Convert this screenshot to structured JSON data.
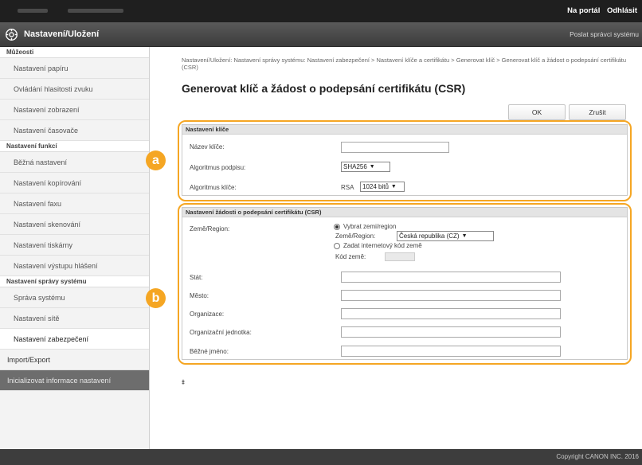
{
  "topbar": {
    "portal_link": "Na portál",
    "logout_link": "Odhlásit"
  },
  "titlebar": {
    "title": "Nastavení/Uložení",
    "mail_link": "Poslat správci systému"
  },
  "sidebar": {
    "cat_preferences": "Můžeosti",
    "items_a": [
      "Nastavení papíru",
      "Ovládání hlasitosti zvuku",
      "Nastavení zobrazení",
      "Nastavení časovače"
    ],
    "cat_functions": "Nastavení funkcí",
    "items_b": [
      "Běžná nastavení",
      "Nastavení kopírování",
      "Nastavení faxu",
      "Nastavení skenování",
      "Nastavení tiskárny",
      "Nastavení výstupu hlášení"
    ],
    "cat_system": "Nastavení správy systému",
    "items_c": [
      "Správa systému",
      "Nastavení sítě",
      "Nastavení zabezpečení"
    ],
    "import_export": "Import/Export",
    "init_info": "Inicializovat informace nastavení"
  },
  "main": {
    "breadcrumb": "Nastavení/Uložení: Nastavení správy systému: Nastavení zabezpečení > Nastavení klíče a certifikátu > Generovat klíč > Generovat klíč a žádost o podepsání certifikátu (CSR)",
    "page_title": "Generovat klíč a žádost o podepsání certifikátu (CSR)",
    "ok_button": "OK",
    "cancel_button": "Zrušit",
    "key_section": {
      "header": "Nastavení klíče",
      "key_name_label": "Název klíče:",
      "key_name_value": "",
      "sig_algo_label": "Algoritmus podpisu:",
      "sig_algo_value": "SHA256",
      "key_algo_label": "Algoritmus klíče:",
      "key_algo_type": "RSA",
      "key_algo_value": "1024 bitů"
    },
    "csr_section": {
      "header": "Nastavení žádosti o podepsání certifikátu (CSR)",
      "country_label": "Země/Region:",
      "radio_select": "Vybrat zemi/region",
      "country_sub_label": "Země/Region:",
      "country_value": "Česká republika (CZ)",
      "radio_internet": "Zadat internetový kód země",
      "country_code_label": "Kód země:",
      "state_label": "Stát:",
      "city_label": "Město:",
      "org_label": "Organizace:",
      "unit_label": "Organizační jednotka:",
      "common_name_label": "Běžné jméno:"
    },
    "to_top": "⯒"
  },
  "annotations": {
    "badge_a": "a",
    "badge_b": "b"
  },
  "footer": {
    "copyright": "Copyright CANON INC. 2016"
  },
  "colors": {
    "accent": "#f5a623",
    "topbar": "#1f1f1f",
    "titlebar": "#4a4a4a"
  }
}
